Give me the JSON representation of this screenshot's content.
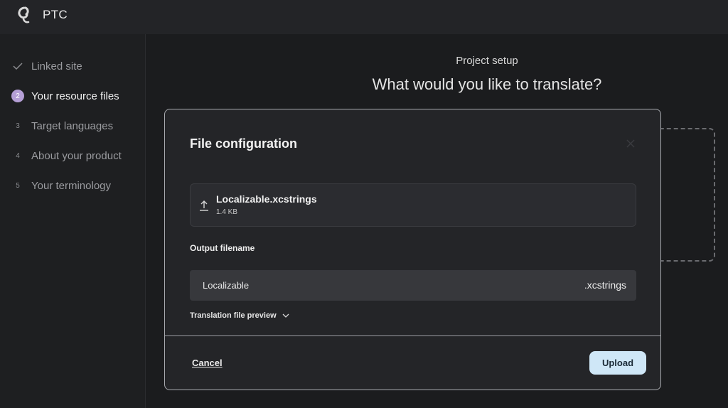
{
  "app": {
    "title": "PTC",
    "logo_icon": "ptc-logo-icon"
  },
  "sidebar": {
    "steps": [
      {
        "marker": "✓",
        "label": "Linked site",
        "state": "done"
      },
      {
        "marker": "2",
        "label": "Your resource files",
        "state": "active"
      },
      {
        "marker": "3",
        "label": "Target languages",
        "state": "pending"
      },
      {
        "marker": "4",
        "label": "About your product",
        "state": "pending"
      },
      {
        "marker": "5",
        "label": "Your terminology",
        "state": "pending"
      }
    ]
  },
  "main": {
    "subtitle": "Project setup",
    "title": "What would you like to translate?"
  },
  "modal": {
    "title": "File configuration",
    "file": {
      "name": "Localizable.xcstrings",
      "size": "1.4 KB"
    },
    "output_label": "Output filename",
    "output_value": "Localizable",
    "output_extension": ".xcstrings",
    "preview_label": "Translation file preview",
    "cancel_label": "Cancel",
    "upload_label": "Upload"
  },
  "colors": {
    "accent": "#b59fd6",
    "upload_button": "#cfe7f7",
    "background": "#1b1c1e"
  }
}
